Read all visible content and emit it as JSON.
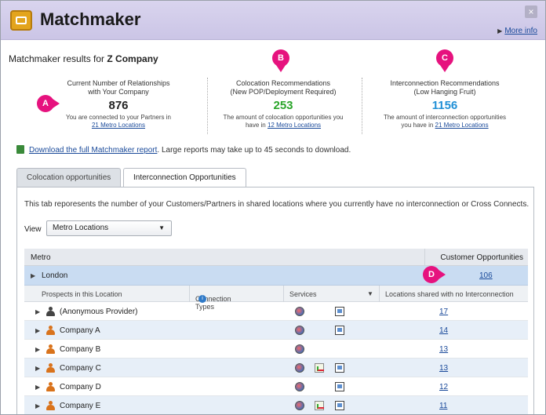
{
  "app": {
    "title": "Matchmaker",
    "close": "×",
    "more_info": "More info"
  },
  "results": {
    "prefix": "Matchmaker results for ",
    "company": "Z Company"
  },
  "stats": [
    {
      "label_1": "Current Number of Relationships",
      "label_2": "with Your Company",
      "value": "876",
      "sub_1": "You are connected to your Partners in",
      "sub_link": "21 Metro Locations",
      "sub_2": "",
      "color": "#222222"
    },
    {
      "label_1": "Colocation Recommendations",
      "label_2": "(New POP/Deployment Required)",
      "value": "253",
      "sub_1": "The amount of colocation opportunities you",
      "sub_2": "have in ",
      "sub_link": "12 Metro Locations",
      "color": "#2aa52a"
    },
    {
      "label_1": "Interconnection Recommendations",
      "label_2": "(Low Hanging Fruit)",
      "value": "1156",
      "sub_1": "The amount of interconnection opportunities",
      "sub_2": "you have in ",
      "sub_link": "21 Metro Locations",
      "color": "#1f8fd6"
    }
  ],
  "callouts": {
    "a": "A",
    "b": "B",
    "c": "C",
    "d": "D",
    "color": "#e6127e"
  },
  "download": {
    "link": "Download the full Matchmaker report",
    "rest": ". Large reports may take up to 45 seconds to download."
  },
  "tabs": [
    {
      "label": "Colocation opportunities",
      "active": false
    },
    {
      "label": "Interconnection Opportunities",
      "active": true
    }
  ],
  "tab_description": "This tab reporesents the number of your Customers/Partners in shared locations where you currently have no interconnection or Cross Connects.",
  "view": {
    "label": "View",
    "selected": "Metro Locations"
  },
  "grid": {
    "col_metro": "Metro",
    "col_opps": "Customer Opportunities",
    "metro": {
      "name": "London",
      "count": "106"
    },
    "sub_cols": {
      "prospects": "Prospects in this Location",
      "connection_types": "Connection Types",
      "services": "Services",
      "locations": "Locations shared with no Interconnection"
    },
    "rows": [
      {
        "name": "(Anonymous Provider)",
        "locations": "17",
        "anon": true
      },
      {
        "name": "Company A",
        "locations": "14",
        "anon": false
      },
      {
        "name": "Company B",
        "locations": "13",
        "anon": false
      },
      {
        "name": "Company C",
        "locations": "13",
        "anon": false
      },
      {
        "name": "Company D",
        "locations": "12",
        "anon": false
      },
      {
        "name": "Company E",
        "locations": "11",
        "anon": false
      }
    ]
  },
  "icons": {
    "logo": "handshake-icon",
    "download": "spreadsheet-icon",
    "info": "info-icon",
    "person": "person-icon",
    "services": [
      "globe-icon",
      "chart-icon",
      "screen-icon"
    ]
  }
}
